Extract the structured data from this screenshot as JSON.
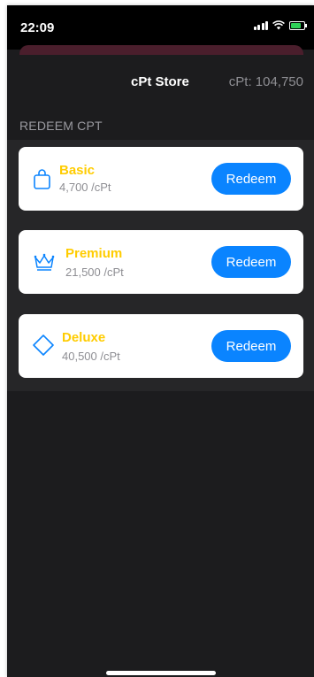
{
  "status_bar": {
    "time": "22:09"
  },
  "nav": {
    "title": "cPt Store",
    "balance": "cPt: 104,750"
  },
  "section": {
    "header": "REDEEM CPT"
  },
  "items": [
    {
      "name": "Basic",
      "price": "4,700 /cPt",
      "icon": "bag-icon",
      "button": "Redeem"
    },
    {
      "name": "Premium",
      "price": "21,500 /cPt",
      "icon": "crown-icon",
      "button": "Redeem"
    },
    {
      "name": "Deluxe",
      "price": "40,500 /cPt",
      "icon": "diamond-icon",
      "button": "Redeem"
    }
  ],
  "colors": {
    "accent": "#0a84ff",
    "item_name": "#ffcc00",
    "background": "#1c1c1e",
    "card": "#ffffff"
  }
}
